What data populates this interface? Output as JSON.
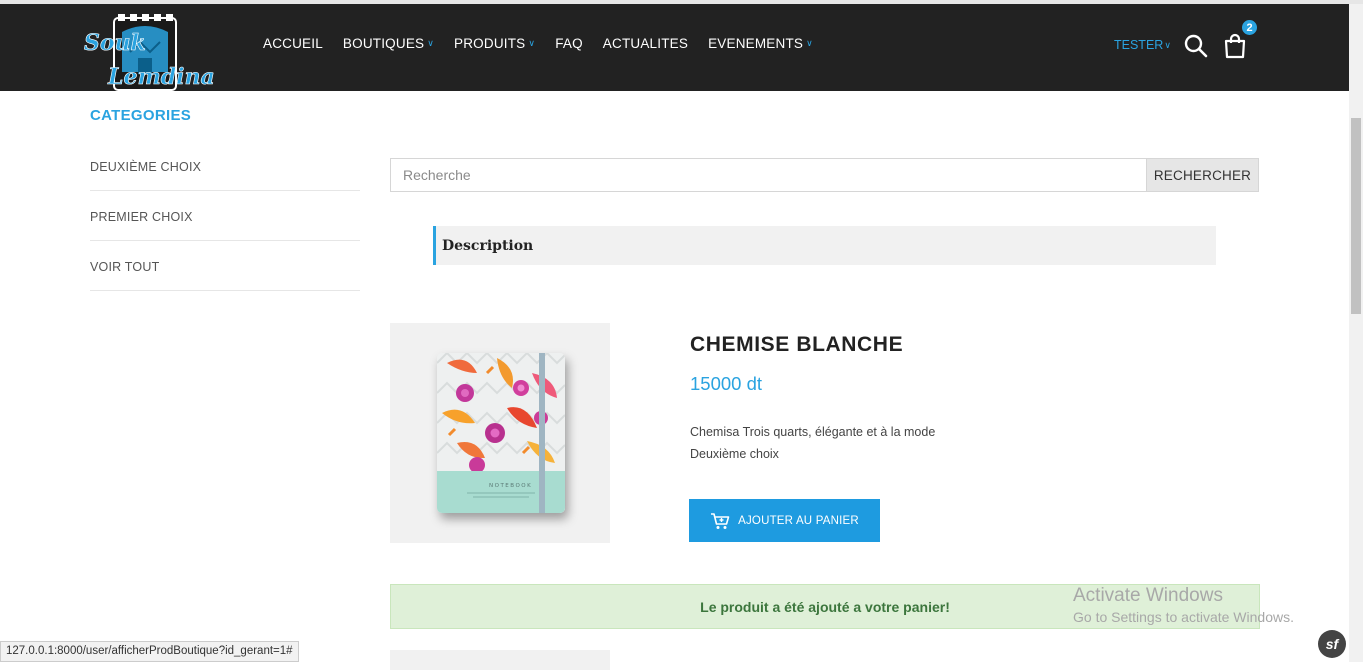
{
  "header": {
    "logo_text": "Souk Lemdina",
    "nav": [
      {
        "label": "ACCUEIL",
        "has_dropdown": false
      },
      {
        "label": "BOUTIQUES",
        "has_dropdown": true
      },
      {
        "label": "PRODUITS",
        "has_dropdown": true
      },
      {
        "label": "FAQ",
        "has_dropdown": false
      },
      {
        "label": "ACTUALITES",
        "has_dropdown": false
      },
      {
        "label": "EVENEMENTS",
        "has_dropdown": true
      }
    ],
    "user_label": "TESTER",
    "cart_count": "2",
    "accent_color": "#2aa3e0"
  },
  "sidebar": {
    "title": "CATEGORIES",
    "items": [
      {
        "label": "DEUXIÈME CHOIX"
      },
      {
        "label": "PREMIER CHOIX"
      },
      {
        "label": "VOIR TOUT"
      }
    ]
  },
  "search": {
    "placeholder": "Recherche",
    "value": "",
    "button_label": "RECHERCHER"
  },
  "tab": {
    "label": "Description"
  },
  "product": {
    "title": "CHEMISE BLANCHE",
    "price": "15000 dt",
    "description_line1": "Chemisa Trois quarts, élégante et à la mode",
    "description_line2": "Deuxième choix",
    "add_button_label": "AJOUTER AU PANIER",
    "image_caption": "NOTEBOOK"
  },
  "alert": {
    "message": "Le produit a été ajouté a votre panier!"
  },
  "watermark": {
    "line1": "Activate Windows",
    "line2": "Go to Settings to activate Windows."
  },
  "status_bar": {
    "url": "127.0.0.1:8000/user/afficherProdBoutique?id_gerant=1#"
  },
  "symfony_badge": "sf"
}
